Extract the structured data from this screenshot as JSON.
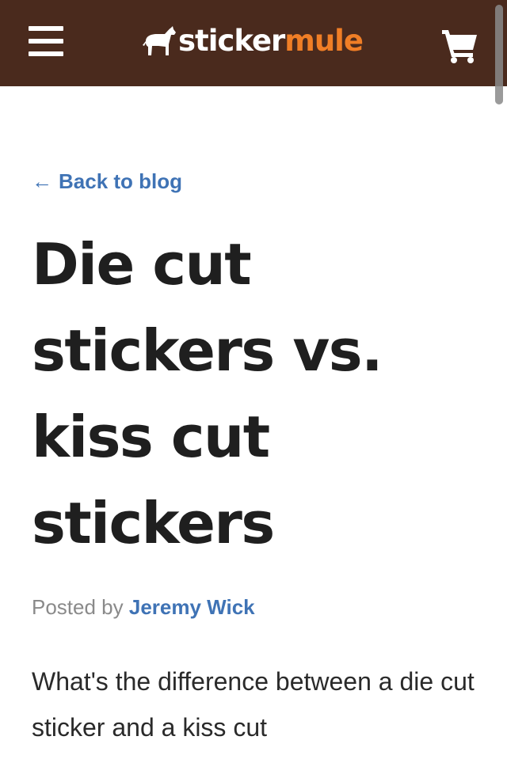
{
  "header": {
    "logo_sticker": "sticker",
    "logo_mule": "mule",
    "background_color": "#4a2a1d",
    "accent_color": "#f07e26",
    "menu_icon": "hamburger-menu-icon",
    "cart_icon": "shopping-cart-icon"
  },
  "article": {
    "back_arrow": "←",
    "back_label": "Back to blog",
    "title": "Die cut stickers vs. kiss cut stickers",
    "posted_by_label": "Posted by",
    "author": "Jeremy Wick",
    "intro": "What's the difference between a die cut sticker and a kiss cut"
  },
  "colors": {
    "link": "#3f73b5",
    "title_text": "#1f1f1f",
    "muted_text": "#8a8a8a"
  }
}
